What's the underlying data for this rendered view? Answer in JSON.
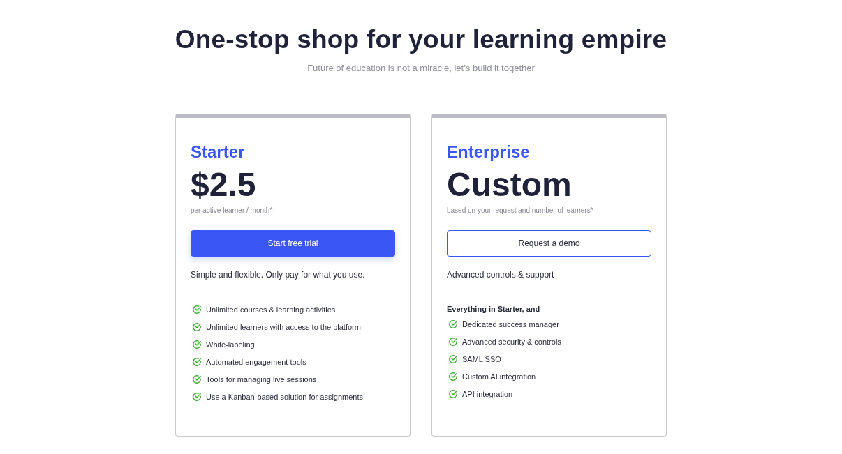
{
  "heading": "One-stop shop for your learning empire",
  "subheading": "Future of education is not a miracle, let’s build it together",
  "plans": [
    {
      "name": "Starter",
      "price": "$2.5",
      "price_note": "per active learner / month*",
      "button": {
        "label": "Start free trial",
        "kind": "primary"
      },
      "summary": "Simple and flexible. Only pay for what you use.",
      "features": [
        "Unlimited courses & learning activities",
        "Unlimited learners with access to the platform",
        "White-labeling",
        "Automated engagement tools",
        "Tools for managing live sessions",
        "Use a Kanban-based solution for assignments"
      ]
    },
    {
      "name": "Enterprise",
      "price": "Custom",
      "price_note": "based on your request and number of learners*",
      "button": {
        "label": "Request a demo",
        "kind": "outline"
      },
      "summary": "Advanced controls & support",
      "features_heading": "Everything in Starter, and",
      "features": [
        "Dedicated success manager",
        "Advanced security & controls",
        "SAML SSO",
        "Custom AI integration",
        "API integration"
      ]
    }
  ]
}
